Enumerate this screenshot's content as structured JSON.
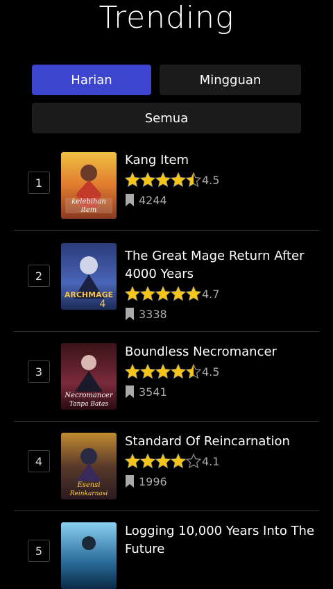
{
  "header": {
    "title": "Trending"
  },
  "tabs": [
    {
      "label": "Harian",
      "active": true
    },
    {
      "label": "Mingguan",
      "active": false
    },
    {
      "label": "Semua",
      "active": false
    }
  ],
  "items": [
    {
      "rank": "1",
      "title": "Kang Item",
      "rating": "4.5",
      "stars": 4.5,
      "bookmarks": "4244",
      "cover_text": "kelebihan item"
    },
    {
      "rank": "2",
      "title": "The Great Mage Return After 4000 Years",
      "rating": "4.7",
      "stars": 5,
      "bookmarks": "3338",
      "cover_text": "ARCHMAGE"
    },
    {
      "rank": "3",
      "title": "Boundless Necromancer",
      "rating": "4.5",
      "stars": 4.5,
      "bookmarks": "3541",
      "cover_text": "Necromancer Tanpa Batas"
    },
    {
      "rank": "4",
      "title": "Standard Of Reincarnation",
      "rating": "4.1",
      "stars": 4,
      "bookmarks": "1996",
      "cover_text": "Esensi Reinkarnasi"
    },
    {
      "rank": "5",
      "title": "Logging 10,000 Years Into The Future",
      "rating": "",
      "stars": 0,
      "bookmarks": "",
      "cover_text": ""
    }
  ],
  "colors": {
    "accent": "#3d45cf",
    "star": "#f5c518",
    "tab_bg": "#1c1c1c"
  }
}
